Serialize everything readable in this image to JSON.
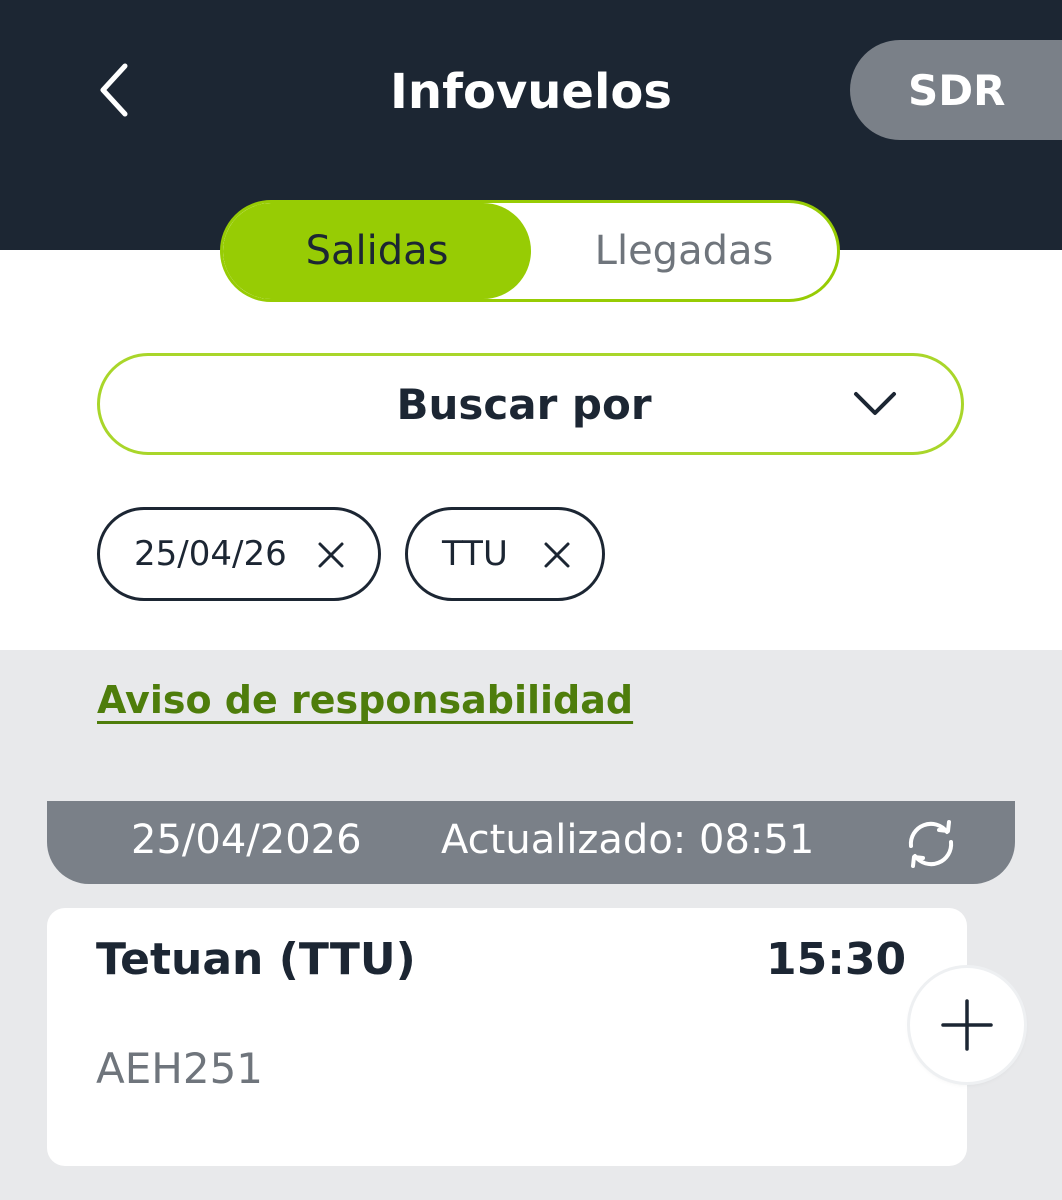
{
  "header": {
    "title": "Infovuelos",
    "airport_code": "SDR",
    "back_icon": "chevron-left-icon"
  },
  "tabs": {
    "active": "Salidas",
    "inactive": "Llegadas"
  },
  "search": {
    "label": "Buscar por",
    "icon": "chevron-down-icon"
  },
  "filters": [
    {
      "label": "25/04/26",
      "icon": "close-icon"
    },
    {
      "label": "TTU",
      "icon": "close-icon"
    }
  ],
  "disclaimer_link": "Aviso de responsabilidad",
  "date_bar": {
    "date": "25/04/2026",
    "updated": "Actualizado: 08:51",
    "icon": "refresh-icon"
  },
  "flights": [
    {
      "destination": "Tetuan (TTU)",
      "time": "15:30",
      "number": "AEH251",
      "action_icon": "plus-icon"
    }
  ],
  "colors": {
    "header_bg": "#1c2633",
    "accent_green": "#97cc04",
    "link_green": "#4e7d0b",
    "gray_bar": "#7a8088",
    "page_bg": "#e8e9eb"
  }
}
